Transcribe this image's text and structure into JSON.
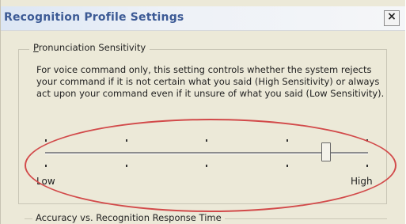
{
  "window": {
    "title": "Recognition Profile Settings",
    "close_glyph": "×",
    "close_icon": "close-icon"
  },
  "pronunciation_group": {
    "legend_first_letter": "P",
    "legend_rest": "ronunciation Sensitivity",
    "description": "For voice command only, this setting controls whether the system rejects your command if it is not certain what you said (High Sensitivity) or always act upon your command even if it unsure of what you said (Low Sensitivity)."
  },
  "sensitivity_slider": {
    "min_label": "Low",
    "max_label": "High",
    "tick_count": 5,
    "value_fraction": 0.875
  },
  "accuracy_group": {
    "legend": "Accuracy vs. Recognition Response Time"
  },
  "annotation": {
    "highlight_color": "#d24a4a"
  }
}
